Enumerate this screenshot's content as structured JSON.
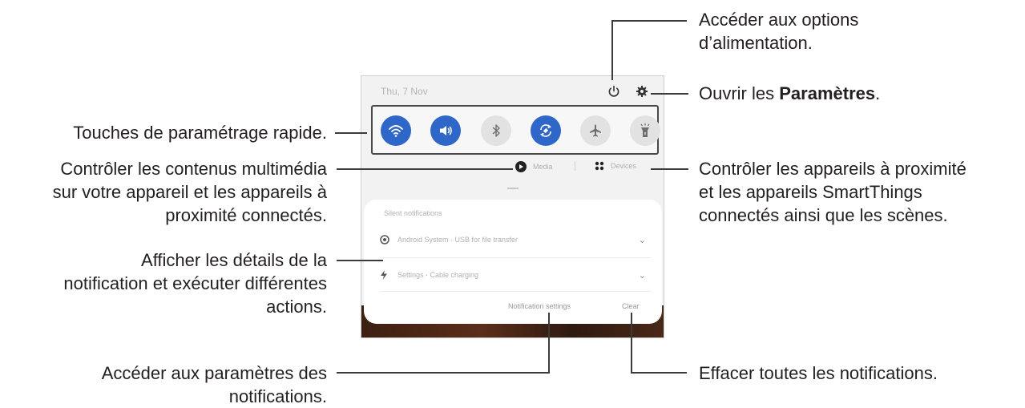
{
  "phone": {
    "date": "Thu, 7 Nov",
    "media_label": "Media",
    "devices_label": "Devices",
    "notifications_title": "Silent notifications",
    "notifications": [
      {
        "icon": "android-system-icon",
        "text": "Android System · USB for file transfer"
      },
      {
        "icon": "lightning-icon",
        "text": "Settings · Cable charging"
      }
    ],
    "notification_settings": "Notification settings",
    "clear": "Clear",
    "quick_settings": [
      {
        "icon": "wifi-icon",
        "on": true
      },
      {
        "icon": "sound-icon",
        "on": true
      },
      {
        "icon": "bluetooth-icon",
        "on": false
      },
      {
        "icon": "auto-rotate-icon",
        "on": true
      },
      {
        "icon": "airplane-icon",
        "on": false
      },
      {
        "icon": "flashlight-icon",
        "on": false
      }
    ],
    "accent_color": "#2f67c9"
  },
  "labels": {
    "power_line1": "Accéder aux options",
    "power_line2": "d’alimentation.",
    "settings_prefix": "Ouvrir les ",
    "settings_bold": "Paramètres",
    "settings_suffix": ".",
    "quick_settings": "Touches de paramétrage rapide.",
    "media_line1": "Contrôler les contenus multimédia",
    "media_line2": "sur votre appareil et les appareils à",
    "media_line3": "proximité connectés.",
    "devices_line1": "Contrôler les appareils à proximité",
    "devices_line2": "et les appareils SmartThings",
    "devices_line3": "connectés ainsi que les scènes.",
    "notif_line1": "Afficher les détails de la",
    "notif_line2": "notification et exécuter différentes",
    "notif_line3": "actions.",
    "notif_settings_line1": "Accéder aux paramètres des",
    "notif_settings_line2": "notifications.",
    "clear_all": "Effacer toutes les notifications."
  }
}
